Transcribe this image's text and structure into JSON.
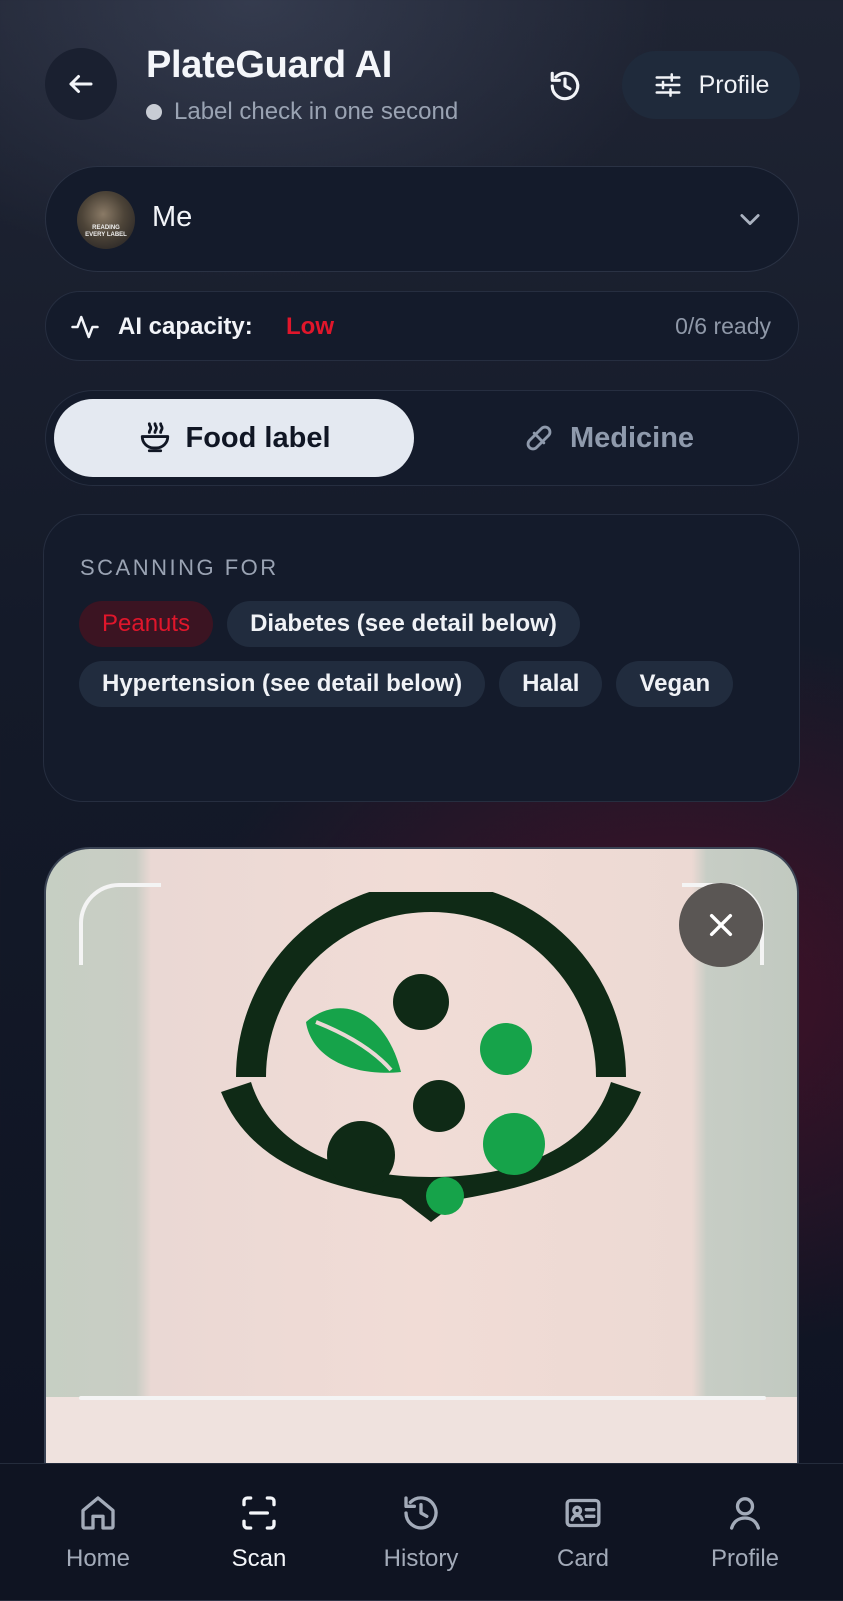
{
  "header": {
    "title": "PlateGuard AI",
    "subtitle": "Label check in one second",
    "profile_label": "Profile"
  },
  "person_selector": {
    "name": "Me",
    "avatar_text_line1": "READING",
    "avatar_text_line2": "EVERY LABEL"
  },
  "capacity": {
    "label": "AI capacity:",
    "value": "Low",
    "ready": "0/6 ready",
    "value_color": "#e0162b"
  },
  "mode_tabs": [
    {
      "label": "Food label",
      "icon": "bowl-icon",
      "active": true
    },
    {
      "label": "Medicine",
      "icon": "pill-icon",
      "active": false
    }
  ],
  "scanning": {
    "heading": "SCANNING FOR",
    "chips": [
      {
        "label": "Peanuts",
        "kind": "danger"
      },
      {
        "label": "Diabetes (see detail below)",
        "kind": "normal"
      },
      {
        "label": "Hypertension (see detail below)",
        "kind": "normal"
      },
      {
        "label": "Halal",
        "kind": "normal"
      },
      {
        "label": "Vegan",
        "kind": "normal"
      }
    ]
  },
  "camera": {
    "close_icon": "close-icon",
    "logo_colors": {
      "dark": "#0f2a16",
      "green": "#16a34a"
    }
  },
  "bottom_nav": {
    "items": [
      {
        "label": "Home",
        "icon": "home-icon",
        "active": false
      },
      {
        "label": "Scan",
        "icon": "scan-icon",
        "active": true
      },
      {
        "label": "History",
        "icon": "history-icon",
        "active": false
      },
      {
        "label": "Card",
        "icon": "card-icon",
        "active": false
      },
      {
        "label": "Profile",
        "icon": "user-icon",
        "active": false
      }
    ]
  }
}
